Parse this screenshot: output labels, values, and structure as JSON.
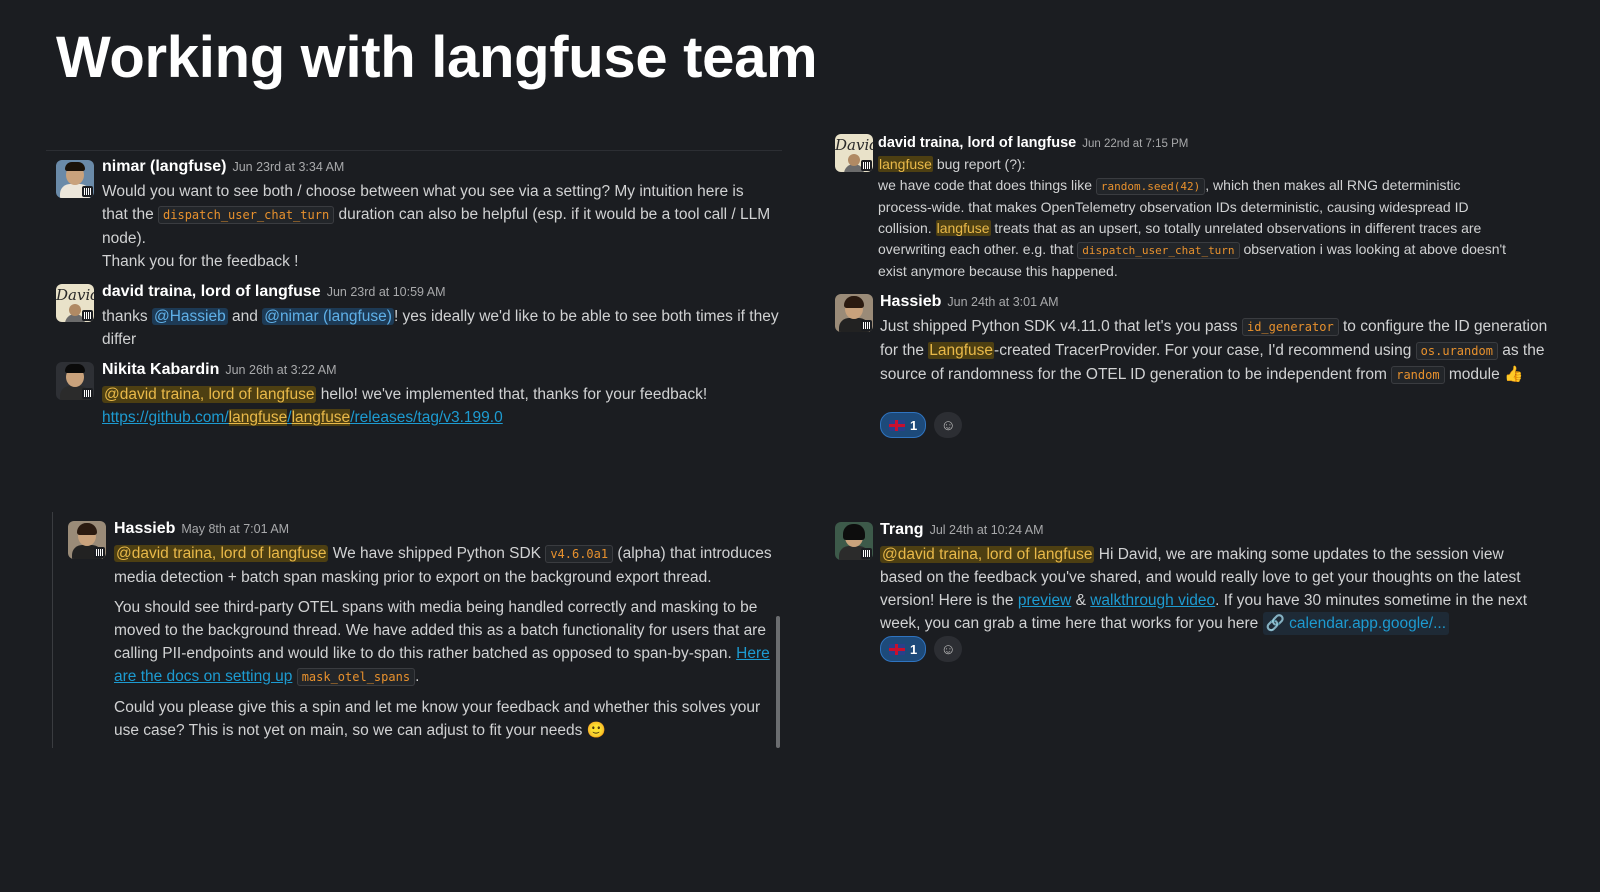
{
  "page": {
    "title": "Working with langfuse team"
  },
  "left_top": {
    "m1": {
      "name": "nimar (langfuse)",
      "time": "Jun 23rd at 3:34 AM",
      "t1": "Would you want to see both / choose between what you see via a setting? My intuition here is that the ",
      "code1": "dispatch_user_chat_turn",
      "t2": " duration can also be helpful (esp. if it would be a tool call / LLM node).",
      "t3": "Thank you for the feedback !"
    },
    "m2": {
      "name": "david traina, lord of langfuse",
      "time": "Jun 23rd at 10:59 AM",
      "t1": "thanks ",
      "mention1": "@Hassieb",
      "t2": " and ",
      "mention2": "@nimar (langfuse)",
      "t3": "! yes ideally we'd like to be able to see both times if they differ"
    },
    "m3": {
      "name": "Nikita Kabardin",
      "time": "Jun 26th at 3:22 AM",
      "mention": "@david traina, lord of langfuse",
      "t1": " hello! we've implemented that, thanks for your feedback!",
      "link_a": "https://github.com/",
      "link_b": "langfuse",
      "link_c": "/",
      "link_d": "langfuse",
      "link_e": "/releases/tag/v3.199.0"
    }
  },
  "left_bottom": {
    "name": "Hassieb",
    "time": "May 8th at 7:01 AM",
    "mention": "@david traina, lord of langfuse",
    "p1a": " We have shipped Python SDK ",
    "code1": "v4.6.0a1",
    "p1b": " (alpha) that introduces media detection + batch span masking prior to export on the background export thread.",
    "p2a": "You should see third-party OTEL spans with media being handled correctly and masking to be moved to the background thread. We have added this as a batch functionality for users that are calling PII-endpoints and would like to do this rather batched as opposed to span-by-span. ",
    "p2link": "Here are the docs on setting up",
    "code2": "mask_otel_spans",
    "p2c": ".",
    "p3": "Could you please give this a spin and let me know your feedback and whether this solves your use case? This is not yet on main, so we can adjust to fit your needs ",
    "emoji": "🙂"
  },
  "right_top": {
    "m1": {
      "name": "david traina, lord of langfuse",
      "time": "Jun 22nd at 7:15 PM",
      "hl1": "langfuse",
      "t0": " bug report (?):",
      "t1": "we have code that does things like ",
      "code1": "random.seed(42)",
      "t2": ", which then makes all RNG deterministic process-wide. that makes OpenTelemetry observation IDs deterministic, causing widespread ID collision. ",
      "hl2": "langfuse",
      "t3": " treats that as an upsert, so totally unrelated observations in different traces are overwriting each other. e.g. that ",
      "code2": "dispatch_user_chat_turn",
      "t4": " observation i was looking at above doesn't exist anymore because this happened."
    },
    "m2": {
      "name": "Hassieb",
      "time": "Jun 24th at 3:01 AM",
      "t1": "Just shipped Python SDK v4.11.0 that let's you pass ",
      "code1": "id_generator",
      "t2": " to configure the ID generation for the ",
      "hl": "Langfuse",
      "t3": "-created TracerProvider. For your case, I'd recommend using ",
      "code2": "os.urandom",
      "t4": " as the source of randomness for the OTEL ID generation to be independent from ",
      "code3": "random",
      "t5": " module ",
      "thumb": "👍",
      "reaction_count": "1",
      "add_reaction": "☺"
    }
  },
  "right_bottom": {
    "name": "Trang",
    "time": "Jul 24th at 10:24 AM",
    "mention": "@david traina, lord of langfuse",
    "t1": " Hi David, we are making some updates to the session view based on the feedback you've shared, and would really love to get your thoughts on the latest version! Here is the ",
    "link1": "preview",
    "t2": " & ",
    "link2": "walkthrough video",
    "t3": ". If you have 30 minutes sometime in the next week, you can grab a time here that works for you here ",
    "chip_icon": "🔗",
    "chip": "calendar.app.google/...",
    "reaction_count": "1",
    "add_reaction": "☺"
  },
  "avatars": {
    "david_text": "David"
  },
  "colors": {
    "background": "#1b1d21",
    "mention_bg": "#4d3f12",
    "mention_fg": "#e9b949",
    "link": "#1d9bd1",
    "code": "#e8912d"
  }
}
